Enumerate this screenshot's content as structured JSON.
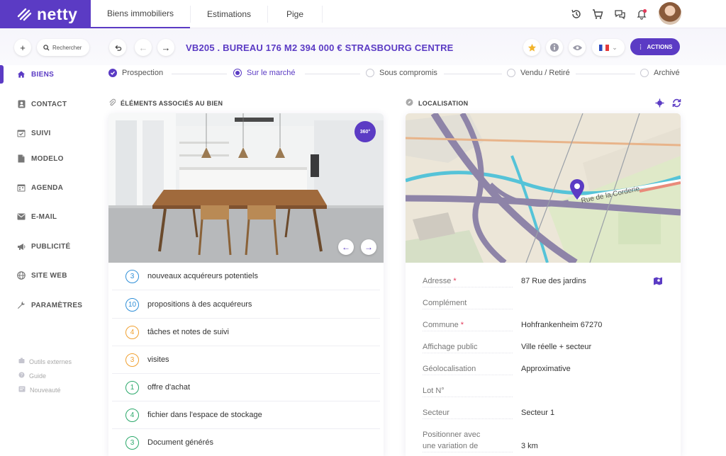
{
  "app": {
    "brand": "netty"
  },
  "top_tabs": [
    {
      "label": "Biens immobiliers",
      "active": true
    },
    {
      "label": "Estimations",
      "active": false
    },
    {
      "label": "Pige",
      "active": false
    }
  ],
  "top_icons": [
    "history-icon",
    "cart-icon",
    "chat-icon",
    "bell-icon"
  ],
  "search": {
    "placeholder": "Rechercher"
  },
  "property": {
    "title": "VB205 . BUREAU 176 M2 394 000 €  STRASBOURG CENTRE"
  },
  "toolbar": {
    "actions_label": "ACTIONS",
    "language_flag": "FR"
  },
  "sidebar": {
    "items": [
      {
        "label": "BIENS",
        "icon": "home-icon",
        "active": true
      },
      {
        "label": "CONTACT",
        "icon": "contact-card-icon"
      },
      {
        "label": "SUIVI",
        "icon": "calendar-check-icon"
      },
      {
        "label": "MODELO",
        "icon": "document-icon"
      },
      {
        "label": "AGENDA",
        "icon": "calendar-icon"
      },
      {
        "label": "E-MAIL",
        "icon": "envelope-icon"
      },
      {
        "label": "PUBLICITÉ",
        "icon": "megaphone-icon"
      },
      {
        "label": "SITE WEB",
        "icon": "globe-icon"
      },
      {
        "label": "PARAMÈTRES",
        "icon": "wrench-icon"
      }
    ],
    "footer": [
      {
        "label": "Outils externes",
        "icon": "tools-icon"
      },
      {
        "label": "Guide",
        "icon": "help-icon"
      },
      {
        "label": "Nouveauté",
        "icon": "news-icon"
      }
    ]
  },
  "steps": [
    {
      "label": "Prospection",
      "state": "done"
    },
    {
      "label": "Sur le marché",
      "state": "current"
    },
    {
      "label": "Sous compromis",
      "state": "todo"
    },
    {
      "label": "Vendu / Retiré",
      "state": "todo"
    },
    {
      "label": "Archivé",
      "state": "todo"
    }
  ],
  "associated": {
    "title": "ÉLÉMENTS ASSOCIÉS AU BIEN",
    "badge_360": "360°",
    "items": [
      {
        "count": "3",
        "label": "nouveaux acquéreurs potentiels",
        "color": "#2f8fd8"
      },
      {
        "count": "10",
        "label": "propositions à des acquéreurs",
        "color": "#2f8fd8"
      },
      {
        "count": "4",
        "label": "tâches et notes de suivi",
        "color": "#f0a030"
      },
      {
        "count": "3",
        "label": "visites",
        "color": "#f0a030"
      },
      {
        "count": "1",
        "label": "offre d'achat",
        "color": "#2aa86a"
      },
      {
        "count": "4",
        "label": "fichier dans l'espace de stockage",
        "color": "#2aa86a"
      },
      {
        "count": "3",
        "label": "Document générés",
        "color": "#2aa86a"
      }
    ]
  },
  "location": {
    "title": "LOCALISATION",
    "map_street_label": "Rue de la Corderie",
    "fields": [
      {
        "label": "Adresse",
        "required": "*",
        "value": "87 Rue des jardins"
      },
      {
        "label": "Complément",
        "required": "",
        "value": ""
      },
      {
        "label": "Commune",
        "required": "*",
        "value": "Hohfrankenheim 67270"
      },
      {
        "label": "Affichage public",
        "required": "",
        "value": "Ville réelle + secteur"
      },
      {
        "label": "Géolocalisation",
        "required": "",
        "value": "Approximative"
      },
      {
        "label": "Lot N°",
        "required": "",
        "value": ""
      },
      {
        "label": "Secteur",
        "required": "",
        "value": "Secteur 1"
      },
      {
        "label": "Positionner avec",
        "required": "",
        "value": "3 km"
      }
    ],
    "last_label_line2": "une variation de"
  },
  "colors": {
    "accent": "#5b3bc4",
    "required": "#e23b5b"
  }
}
